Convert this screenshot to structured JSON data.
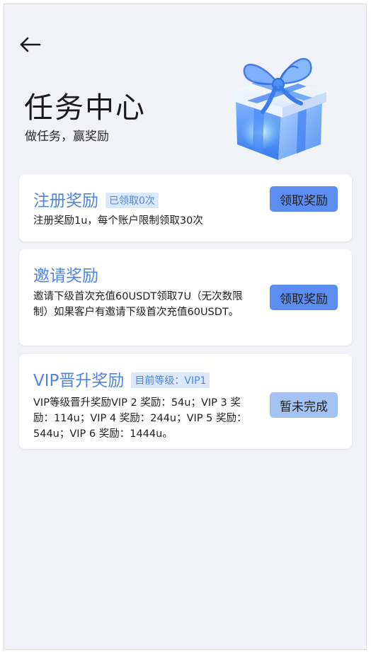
{
  "header": {
    "title": "任务中心",
    "subtitle": "做任务，赢奖励"
  },
  "colors": {
    "accent": "#4e85e6",
    "button_active": "#5b8ef0",
    "button_disabled": "#a5c2f5",
    "badge_bg": "#dbe7fb",
    "background": "#f2f3f8"
  },
  "cards": [
    {
      "title": "注册奖励",
      "badge": "已领取0次",
      "description": "注册奖励1u，每个账户限制领取30次",
      "button": "领取奖励"
    },
    {
      "title": "邀请奖励",
      "badge": "",
      "description": "邀请下级首次充值60USDT领取7U（无次数限制）如果客户有邀请下级首次充值60USDT。",
      "button": "领取奖励"
    },
    {
      "title": "VIP晋升奖励",
      "badge": "目前等级：VIP1",
      "description": "VIP等级晋升奖励VIP 2 奖励：54u；VIP 3 奖励：114u；VIP 4 奖励：244u；VIP 5 奖励：544u；VIP 6 奖励：1444u。",
      "button": "暂未完成"
    }
  ]
}
